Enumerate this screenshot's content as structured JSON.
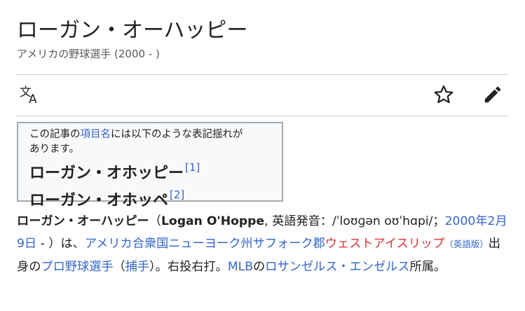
{
  "header": {
    "title": "ローガン・オーハッピー",
    "subtitle": "アメリカの野球選手 (2000 - )"
  },
  "toolbar": {
    "language_icon": "translate-icon",
    "watch_icon": "star-icon",
    "edit_icon": "pencil-icon"
  },
  "notice": {
    "line1_before": "この記事の",
    "line1_link": "項目名",
    "line1_after": "には以下のような表記揺れが",
    "line2": "あります。",
    "alt1": "ローガン・オホッピー",
    "alt1_ref": "[1]",
    "alt2": "ローガン・オホッペ",
    "alt2_ref": "[2]"
  },
  "article": {
    "name_ja": "ローガン・オーハッピー",
    "paren_open": "（",
    "name_en": "Logan O'Hoppe",
    "pron_label": ", 英語発音：/ˈloʊɡən oʊˈhɑpi/；",
    "birth_link": "2000年2月9日",
    "after_birth": " - ）は、",
    "country_link": "アメリカ合衆国",
    "state_link": "ニューヨーク州",
    "county_link": "サフォーク郡",
    "town_link_red": "ウェストアイスリップ",
    "en_version": "（英語版）",
    "origin": "出身の",
    "job_link": "プロ野球選手",
    "pos_open": "（",
    "pos_link": "捕手",
    "pos_close": "）。右投右打。",
    "league_link": "MLB",
    "no": "の",
    "team_link": "ロサンゼルス・エンゼルス",
    "belongs": "所属。"
  },
  "colors": {
    "link": "#3366cc",
    "redlink": "#dd3333",
    "text": "#202122",
    "muted": "#54595d"
  }
}
